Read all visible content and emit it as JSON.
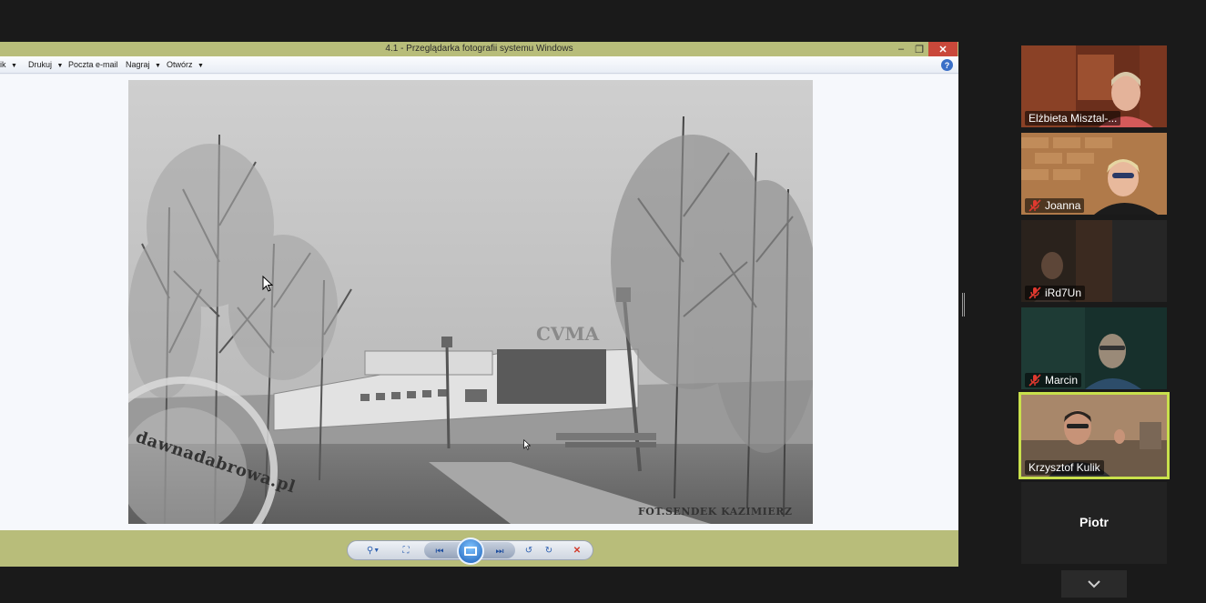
{
  "window": {
    "title": "4.1 - Przeglądarka fotografii systemu Windows",
    "minimize_glyph": "–",
    "maximize_glyph": "❐",
    "close_glyph": "✕"
  },
  "menubar": {
    "items": [
      {
        "label": "ik",
        "has_caret": false
      },
      {
        "label": "Drukuj",
        "has_caret": true
      },
      {
        "label": "Poczta e-mail",
        "has_caret": false
      },
      {
        "label": "Nagraj",
        "has_caret": true
      },
      {
        "label": "Otwórz",
        "has_caret": true
      }
    ],
    "help_glyph": "?"
  },
  "photo": {
    "sign_text": "CVMA",
    "watermark_site": "dawnadabrowa.pl",
    "credit": "FOT.SENDEK KAZIMIERZ"
  },
  "controls": {
    "zoom_glyph": "⚲",
    "fit_glyph": "⛶",
    "prev_glyph": "⏮",
    "next_glyph": "⏭",
    "rotate_ccw_glyph": "↺",
    "rotate_cw_glyph": "↻",
    "delete_glyph": "✕"
  },
  "participants": [
    {
      "name": "Elżbieta Misztal-...",
      "muted": false,
      "active": false
    },
    {
      "name": "Joanna",
      "muted": true,
      "active": false
    },
    {
      "name": "iRd7Un",
      "muted": true,
      "active": false
    },
    {
      "name": "Marcin",
      "muted": true,
      "active": false
    },
    {
      "name": "Krzysztof Kulik",
      "muted": false,
      "active": true
    }
  ],
  "no_video_participant": {
    "name": "Piotr"
  },
  "colors": {
    "window_chrome": "#b8bd7a",
    "active_speaker": "#c9e04c",
    "mute_red": "#e0392f"
  }
}
